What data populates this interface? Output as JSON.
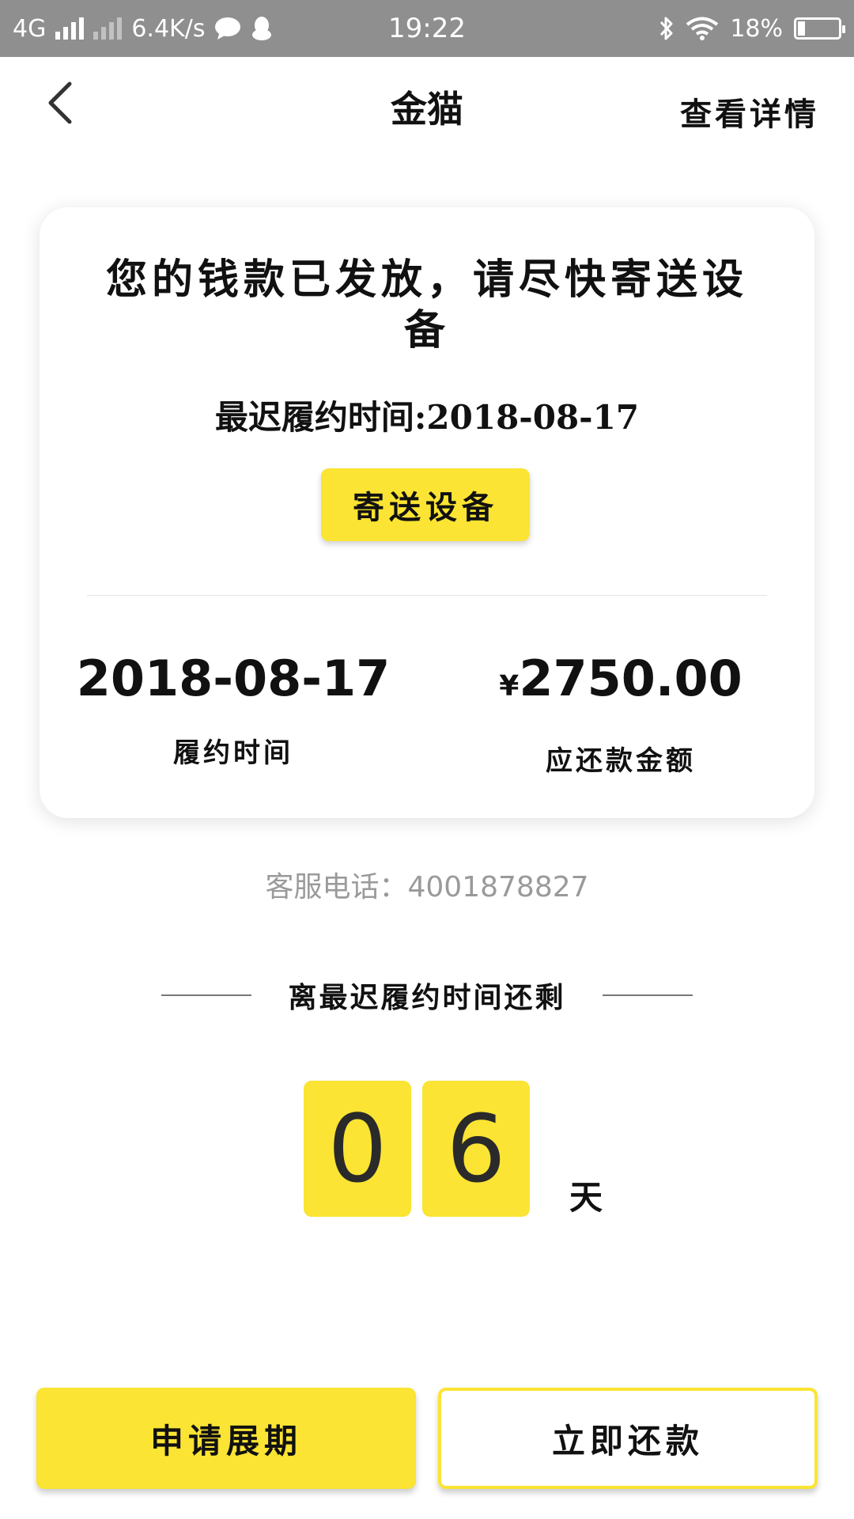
{
  "status_bar": {
    "network": "4G",
    "speed": "6.4K/s",
    "time": "19:22",
    "battery": "18%",
    "battery_level": 0.18
  },
  "header": {
    "title": "金猫",
    "detail_link": "查看详情"
  },
  "card": {
    "message": "您的钱款已发放，请尽快寄送设备",
    "deadline_text": "最迟履约时间:2018-08-17",
    "send_button": "寄送设备",
    "stat_left": {
      "value": "2018-08-17",
      "label": "履约时间"
    },
    "stat_right": {
      "currency": "¥",
      "value": "2750.00",
      "label": "应还款金额"
    }
  },
  "service": {
    "label": "客服电话：",
    "phone": "4001878827"
  },
  "countdown": {
    "title": "离最迟履约时间还剩",
    "digit_1": "0",
    "digit_2": "6",
    "unit": "天"
  },
  "actions": {
    "extend_label": "申请展期",
    "repay_label": "立即还款"
  },
  "colors": {
    "accent": "#fbe433",
    "status_bar": "#8f8f8f"
  }
}
